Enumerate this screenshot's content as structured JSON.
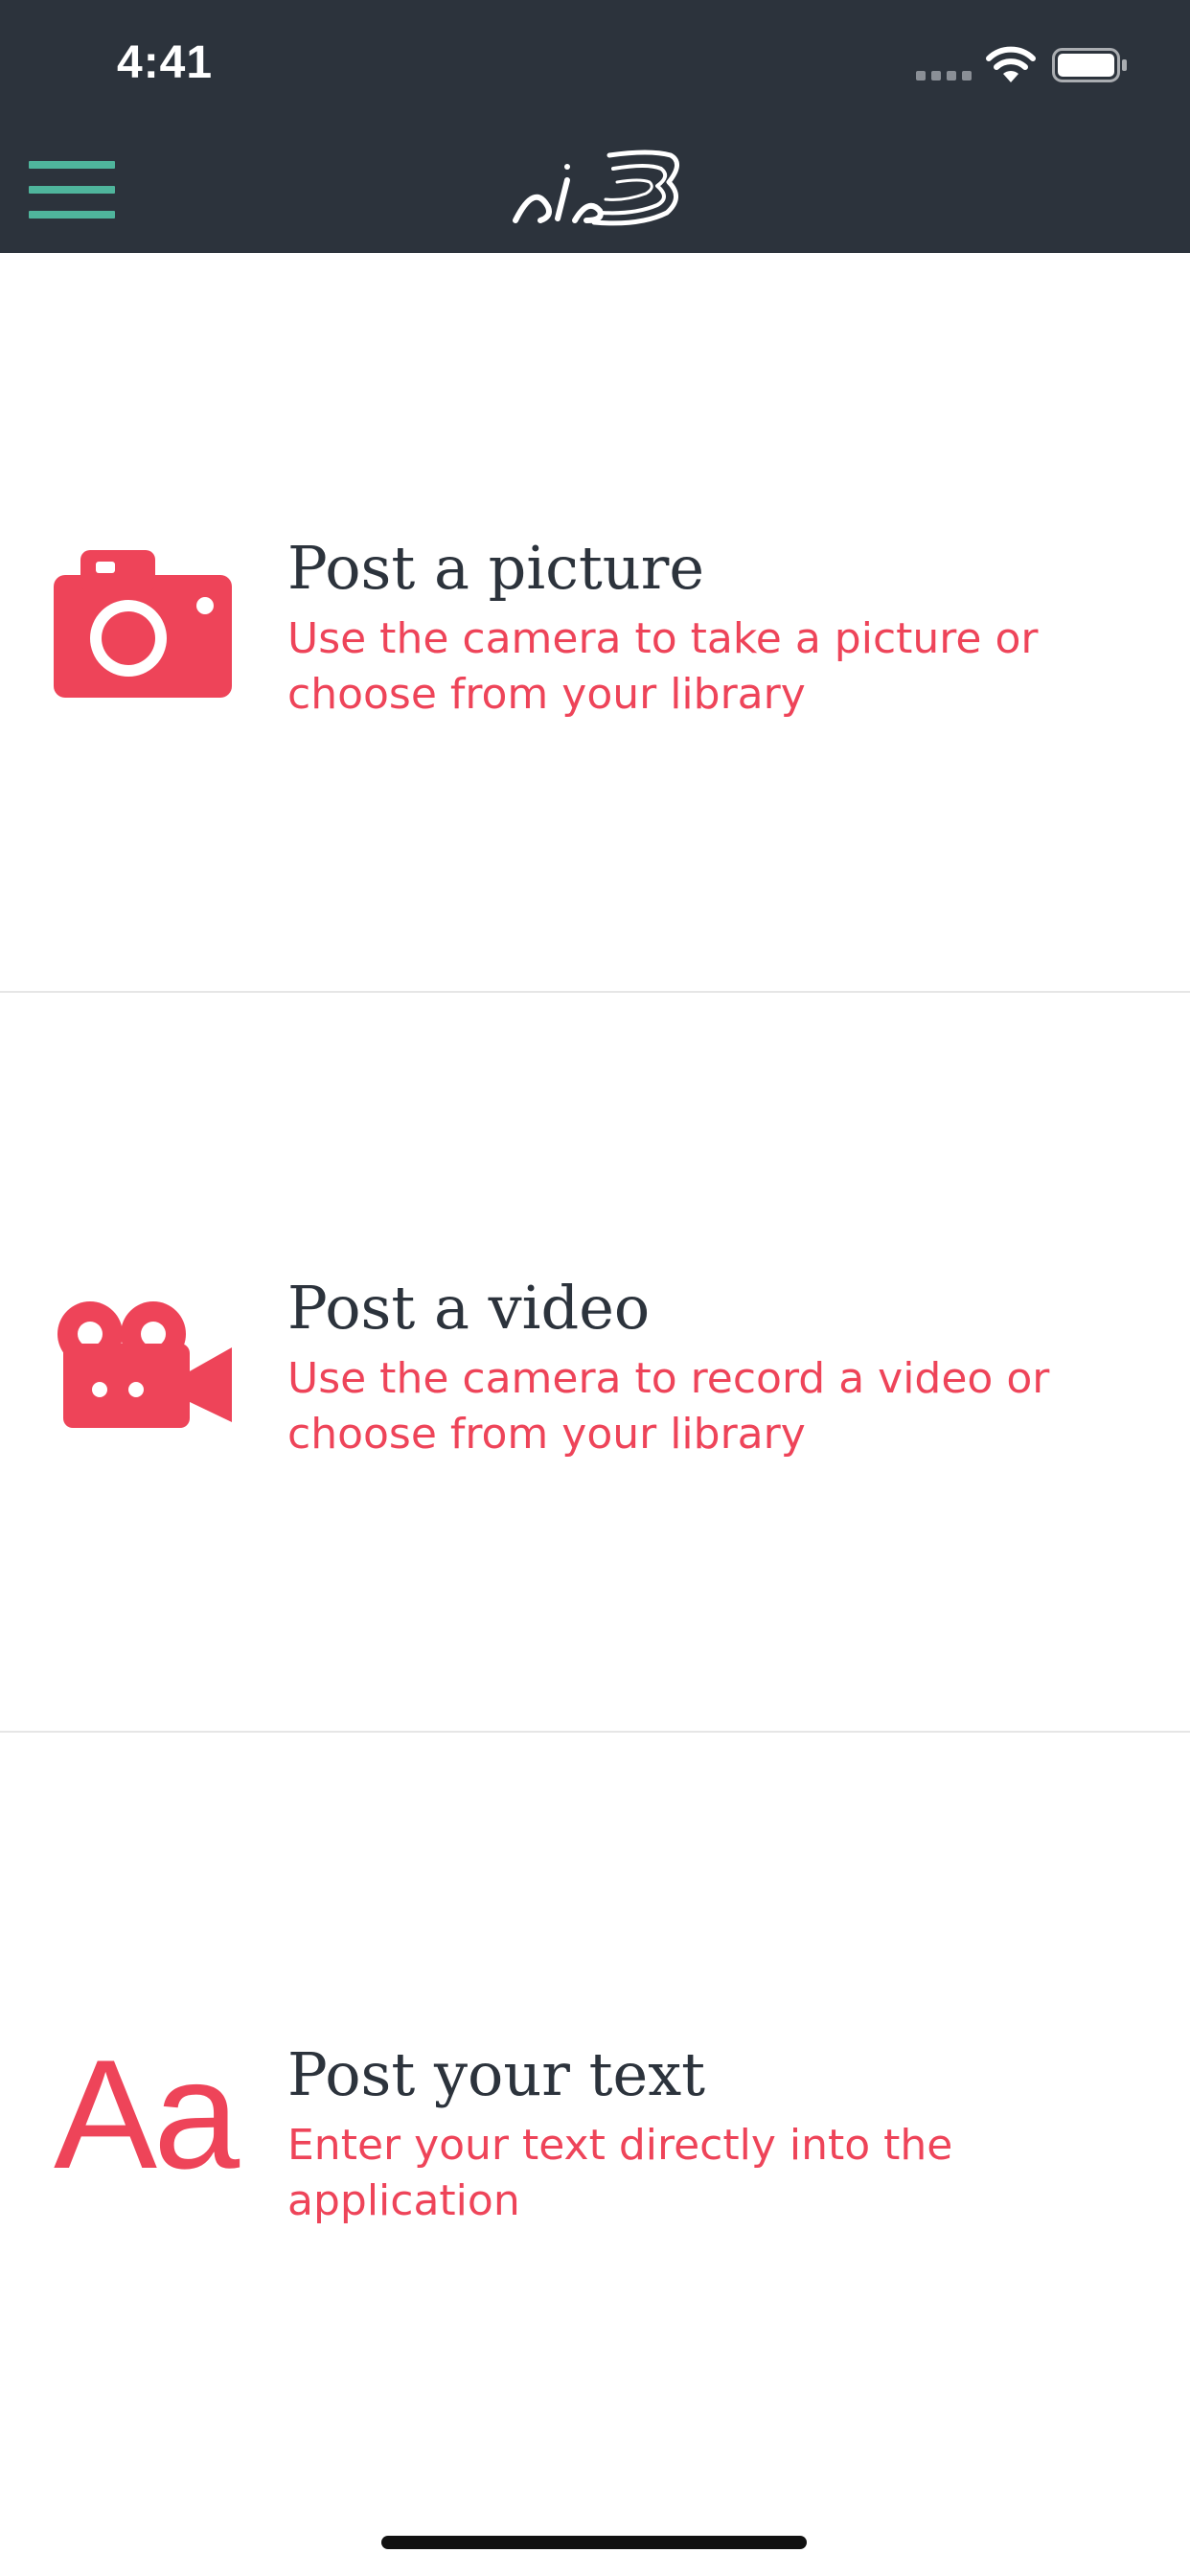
{
  "status_bar": {
    "time": "4:41",
    "icons": [
      "signal-dots-icon",
      "wifi-icon",
      "battery-icon"
    ]
  },
  "header": {
    "menu_icon": "hamburger-menu-icon",
    "logo": "brand-logo"
  },
  "options": [
    {
      "icon": "camera-icon",
      "title": "Post a picture",
      "description": "Use the camera to take a picture or choose from your library"
    },
    {
      "icon": "video-camera-icon",
      "title": "Post a video",
      "description": "Use the camera to record a video or choose from your library"
    },
    {
      "icon": "text-aa-icon",
      "icon_text": "Aa",
      "title": "Post your text",
      "description": "Enter your text directly into the application"
    }
  ],
  "colors": {
    "header_bg": "#2c333c",
    "accent_red": "#ee4459",
    "menu_green": "#4fb59c",
    "title_dark": "#2c333c",
    "divider": "#e6e6e6"
  }
}
